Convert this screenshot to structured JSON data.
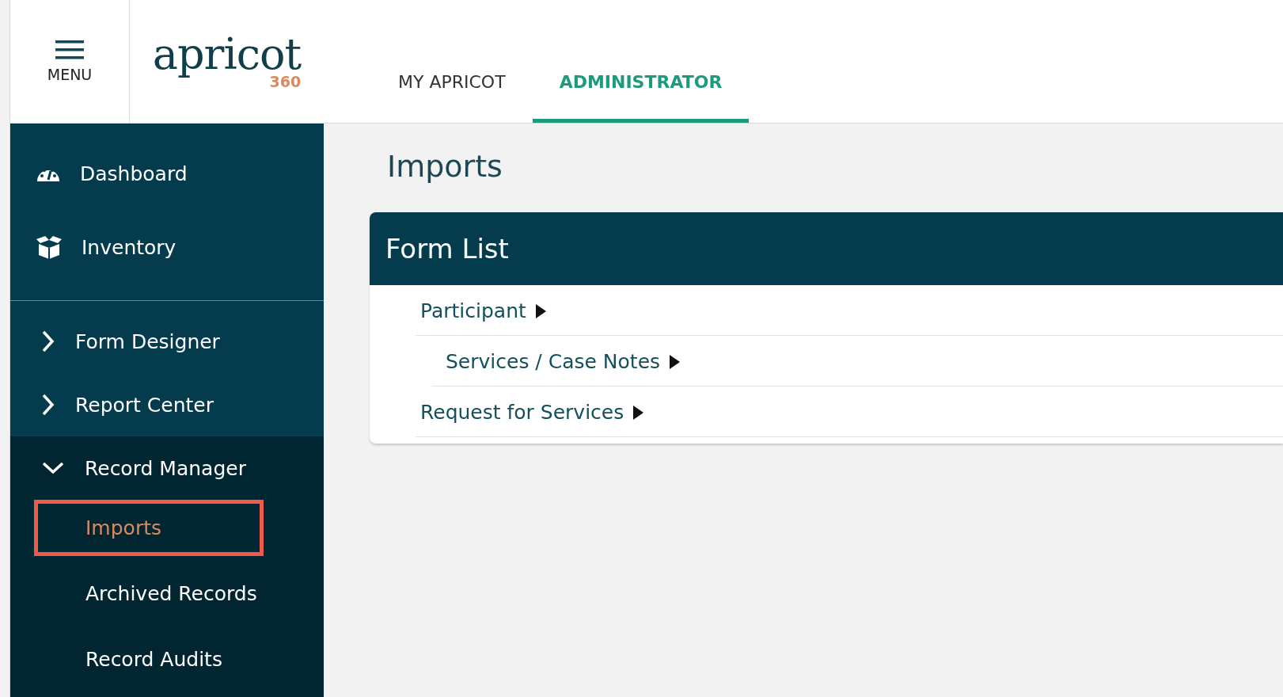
{
  "header": {
    "menu_label": "MENU",
    "logo": {
      "wordmark": "apricot",
      "suffix": "360"
    },
    "tabs": [
      {
        "label": "MY APRICOT",
        "selected": false
      },
      {
        "label": "ADMINISTRATOR",
        "selected": true
      }
    ]
  },
  "sidebar": {
    "items": [
      {
        "label": "Dashboard"
      },
      {
        "label": "Inventory"
      }
    ],
    "groups": [
      {
        "label": "Form Designer",
        "expanded": false
      },
      {
        "label": "Report Center",
        "expanded": false
      },
      {
        "label": "Record Manager",
        "expanded": true,
        "children": [
          {
            "label": "Imports",
            "selected": true,
            "highlighted": true
          },
          {
            "label": "Archived Records",
            "selected": false,
            "highlighted": false
          },
          {
            "label": "Record Audits",
            "selected": false,
            "highlighted": false
          }
        ]
      }
    ]
  },
  "page": {
    "title": "Imports",
    "form_list": {
      "title": "Form List",
      "items": [
        {
          "label": "Participant",
          "children": [
            {
              "label": "Services / Case Notes"
            }
          ]
        },
        {
          "label": "Request for Services"
        }
      ]
    }
  }
}
